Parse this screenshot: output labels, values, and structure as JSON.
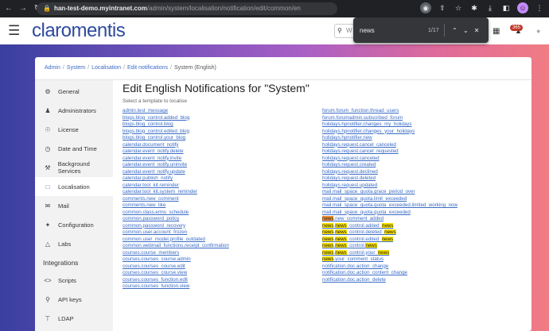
{
  "browser": {
    "url_host": "han-test-demo.myintranet.com",
    "url_path": "/admin/system/localisation/notification/edit/common/en"
  },
  "find": {
    "query": "news",
    "count": "1/17"
  },
  "header": {
    "logo": "claromentis",
    "search_placeholder": "W",
    "notification_count": "365"
  },
  "breadcrumb": [
    "Admin",
    "System",
    "Localisation",
    "Edit notifications",
    "System (English)"
  ],
  "sidebar": {
    "items": [
      {
        "label": "General",
        "icon": "gear-icon"
      },
      {
        "label": "Administrators",
        "icon": "users-icon"
      },
      {
        "label": "License",
        "icon": "shield-icon"
      },
      {
        "label": "Date and Time",
        "icon": "clock-icon"
      },
      {
        "label": "Background Services",
        "icon": "tools-icon"
      },
      {
        "label": "Localisation",
        "icon": "translate-icon"
      },
      {
        "label": "Mail",
        "icon": "mail-icon"
      },
      {
        "label": "Configuration",
        "icon": "wrench-icon"
      },
      {
        "label": "Labs",
        "icon": "flask-icon"
      }
    ],
    "heading": "Integrations",
    "integration_items": [
      {
        "label": "Scripts",
        "icon": "code-icon"
      },
      {
        "label": "API keys",
        "icon": "key-icon"
      },
      {
        "label": "LDAP",
        "icon": "sitemap-icon"
      }
    ]
  },
  "main": {
    "title": "Edit English Notifications for \"System\"",
    "subtitle": "Select a template to localise",
    "left_links": [
      "admin.test_message",
      "blogs.blog_control.added_blog",
      "blogs.blog_control.blog",
      "blogs.blog_control.edited_blog",
      "blogs.blog_control.your_blog",
      "calendar.document_notify",
      "calendar.event_notify.delete",
      "calendar.event_notify.invite",
      "calendar.event_notify.uninvite",
      "calendar.event_notify.update",
      "calendar.publish_notify",
      "calendar.tool_kit.reminder",
      "calendar.tool_kit.system_reminder",
      "comments.new_comment",
      "comments.new_like",
      "common.class.erms_schedule",
      "common.password_policy",
      "common.password_recovery",
      "common.user.account_frozen",
      "common.user_model.profile_outdated",
      "common.webmail_functions.receipt_confirmation",
      "courses.course_members",
      "courses.courses_course.admin",
      "courses.courses_course.edit",
      "courses.courses_course.view",
      "courses.courses_function.edit",
      "courses.courses_function.view"
    ],
    "right_links": [
      "forum.forum_function.thread_users",
      "forum.forumadmin.subscribed_forum",
      "holidays.hpnotifier.changes_my_holidays",
      "holidays.hpnotifier.changes_your_holidays",
      "holidays.hpnotifier.new",
      "holidays.request.cancel_canceled",
      "holidays.request.cancel_requested",
      "holidays.request.canceled",
      "holidays.request.created",
      "holidays.request.declined",
      "holidays.request.deleted",
      "holidays.request.updated",
      "mail.mail_space_quota.grace_period_over",
      "mail.mail_space_quota.limit_exceeded",
      "mail.mail_space_quota.quota_exceeded.limited_working_now",
      "mail.mail_space_quota.quota_exceeded",
      "news.new_comment_added",
      "news.news_control.added_news",
      "news.news_control.deleted_news",
      "news.news_control.edited_news",
      "news.news_control.news",
      "news.news_control.your_news",
      "news.your_comment_status",
      "notification.doc.action_change",
      "notification.doc.action_content_change",
      "notification.doc.action_delete"
    ]
  },
  "colors": {
    "link": "#3a6bc4",
    "highlight": "#ffe600",
    "current_match": "#ff9632",
    "logo": "#2e4a9e"
  }
}
